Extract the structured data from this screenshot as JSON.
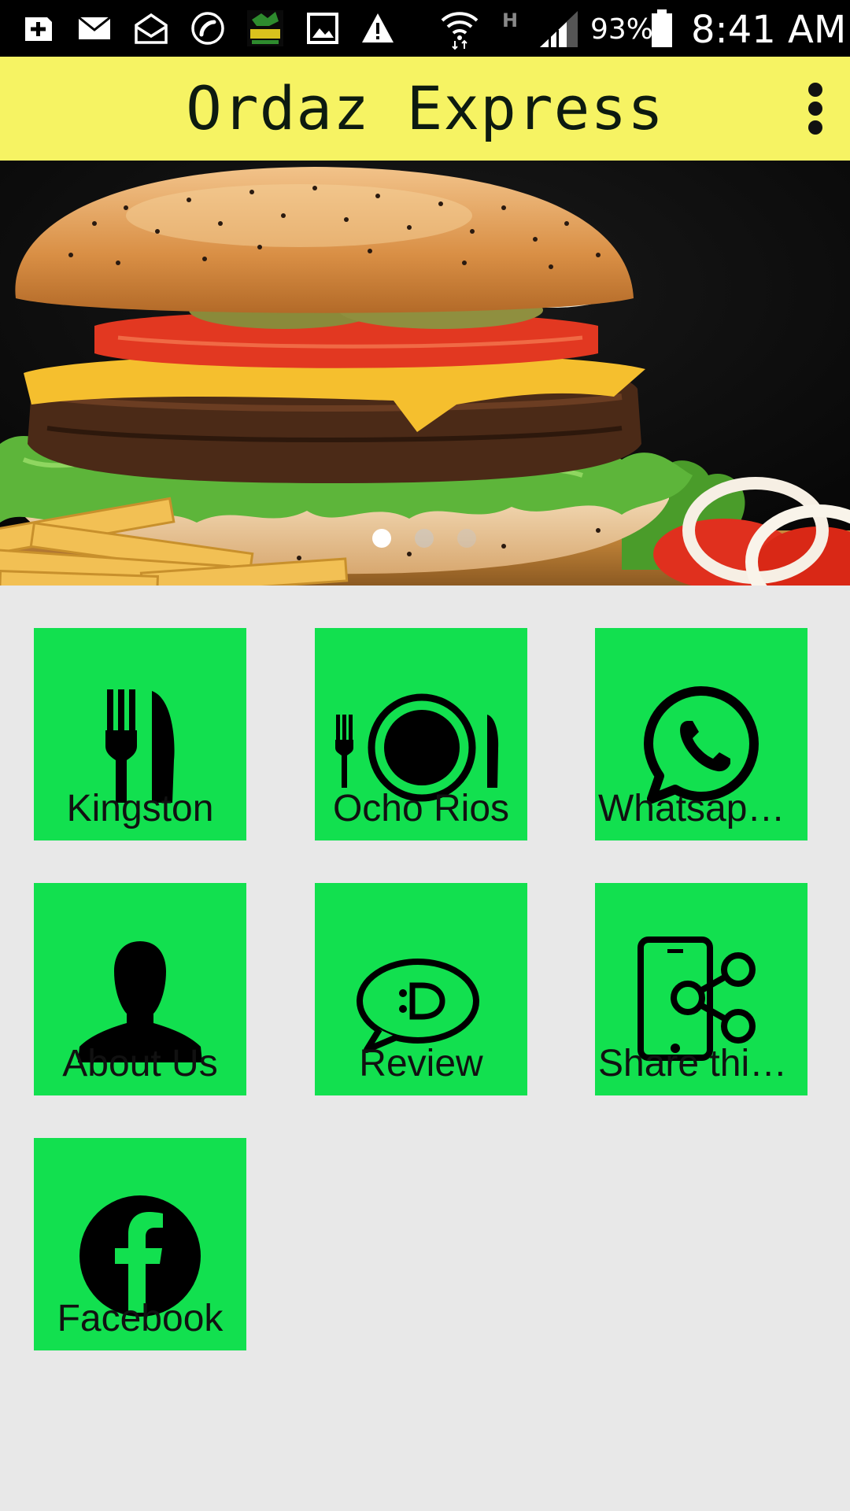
{
  "status_bar": {
    "battery_percent": "93%",
    "time": "8:41 AM",
    "network_type": "H",
    "icons": [
      "add-box-icon",
      "mail-icon",
      "open-mail-icon",
      "call-icon",
      "app-logo-icon",
      "image-icon",
      "warning-icon",
      "wifi-icon",
      "signal-icon",
      "battery-icon"
    ]
  },
  "app_bar": {
    "title": "Ordaz Express",
    "menu_icon": "more-vert-icon",
    "background": "#f6f363"
  },
  "banner": {
    "slide_count": 3,
    "active_slide": 1
  },
  "tiles": [
    {
      "label": "Kingston",
      "icon": "fork-knife-icon"
    },
    {
      "label": "Ocho Rios",
      "icon": "plate-cutlery-icon"
    },
    {
      "label": "Whatsapp…",
      "icon": "whatsapp-icon"
    },
    {
      "label": "About Us",
      "icon": "person-icon"
    },
    {
      "label": "Review",
      "icon": "chat-bubble-icon"
    },
    {
      "label": "Share this…",
      "icon": "share-phone-icon"
    },
    {
      "label": "Facebook",
      "icon": "facebook-icon"
    }
  ],
  "colors": {
    "tile": "#12e04f",
    "background": "#e8e8e8",
    "appbar": "#f6f363"
  }
}
